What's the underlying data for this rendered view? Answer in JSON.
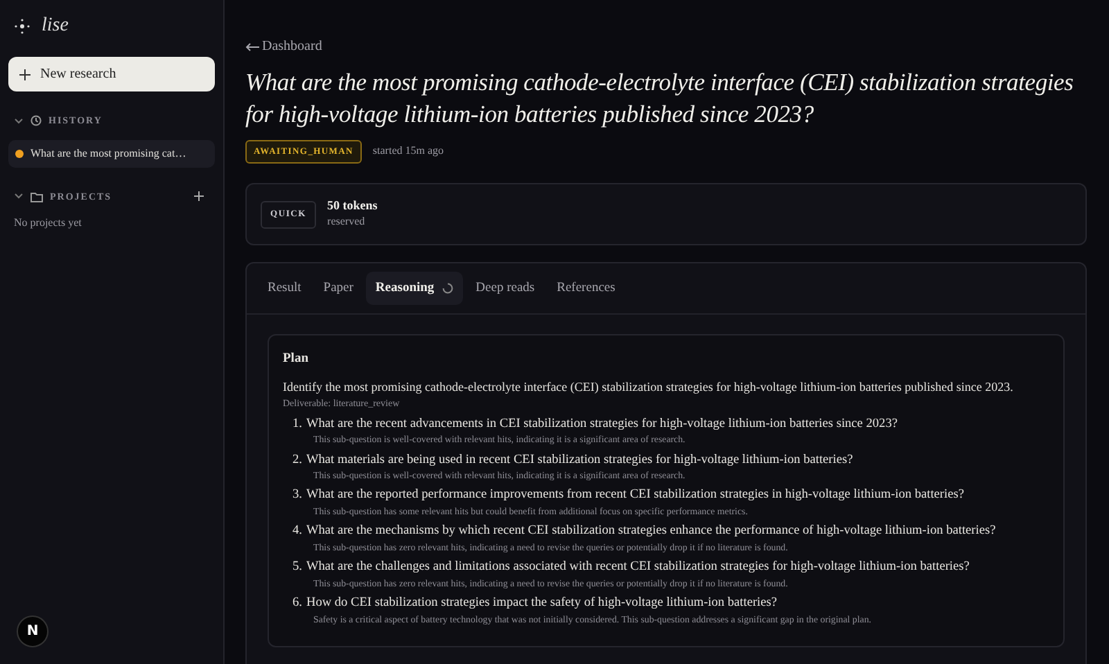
{
  "app": {
    "name": "lise"
  },
  "sidebar": {
    "new_button": "New research",
    "history": {
      "label": "HISTORY",
      "expanded": true,
      "items": [
        {
          "title": "What are the most promising cat…",
          "selected": true,
          "color": "#f0a020"
        }
      ]
    },
    "projects": {
      "label": "PROJECTS",
      "expanded": true,
      "empty": "No projects yet"
    },
    "dev_badge": "N"
  },
  "header": {
    "back": "Dashboard",
    "title": "What are the most promising cathode-electrolyte interface (CEI) stabilization strategies for high-voltage lithium-ion batteries published since 2023?",
    "status": "AWAITING_HUMAN",
    "started": "started 15m ago"
  },
  "budget": {
    "mode": "QUICK",
    "tokens": "50 tokens",
    "note": "reserved"
  },
  "tabs": [
    {
      "label": "Result",
      "selected": false,
      "loading": false
    },
    {
      "label": "Paper",
      "selected": false,
      "loading": false
    },
    {
      "label": "Reasoning",
      "selected": true,
      "loading": true
    },
    {
      "label": "Deep reads",
      "selected": false,
      "loading": false
    },
    {
      "label": "References",
      "selected": false,
      "loading": false
    }
  ],
  "plan": {
    "heading": "Plan",
    "objective": "Identify the most promising cathode-electrolyte interface (CEI) stabilization strategies for high-voltage lithium-ion batteries published since 2023.",
    "deliverable": "Deliverable: literature_review",
    "questions": [
      {
        "number": "1.",
        "text": "What are the recent advancements in CEI stabilization strategies for high-voltage lithium-ion batteries since 2023?",
        "note": "This sub-question is well-covered with relevant hits, indicating it is a significant area of research."
      },
      {
        "number": "2.",
        "text": "What materials are being used in recent CEI stabilization strategies for high-voltage lithium-ion batteries?",
        "note": "This sub-question is well-covered with relevant hits, indicating it is a significant area of research."
      },
      {
        "number": "3.",
        "text": "What are the reported performance improvements from recent CEI stabilization strategies in high-voltage lithium-ion batteries?",
        "note": "This sub-question has some relevant hits but could benefit from additional focus on specific performance metrics."
      },
      {
        "number": "4.",
        "text": "What are the mechanisms by which recent CEI stabilization strategies enhance the performance of high-voltage lithium-ion batteries?",
        "note": "This sub-question has zero relevant hits, indicating a need to revise the queries or potentially drop it if no literature is found."
      },
      {
        "number": "5.",
        "text": "What are the challenges and limitations associated with recent CEI stabilization strategies for high-voltage lithium-ion batteries?",
        "note": "This sub-question has zero relevant hits, indicating a need to revise the queries or potentially drop it if no literature is found."
      },
      {
        "number": "6.",
        "text": "How do CEI stabilization strategies impact the safety of high-voltage lithium-ion batteries?",
        "note": "Safety is a critical aspect of battery technology that was not initially considered. This sub-question addresses a significant gap in the original plan."
      }
    ]
  }
}
